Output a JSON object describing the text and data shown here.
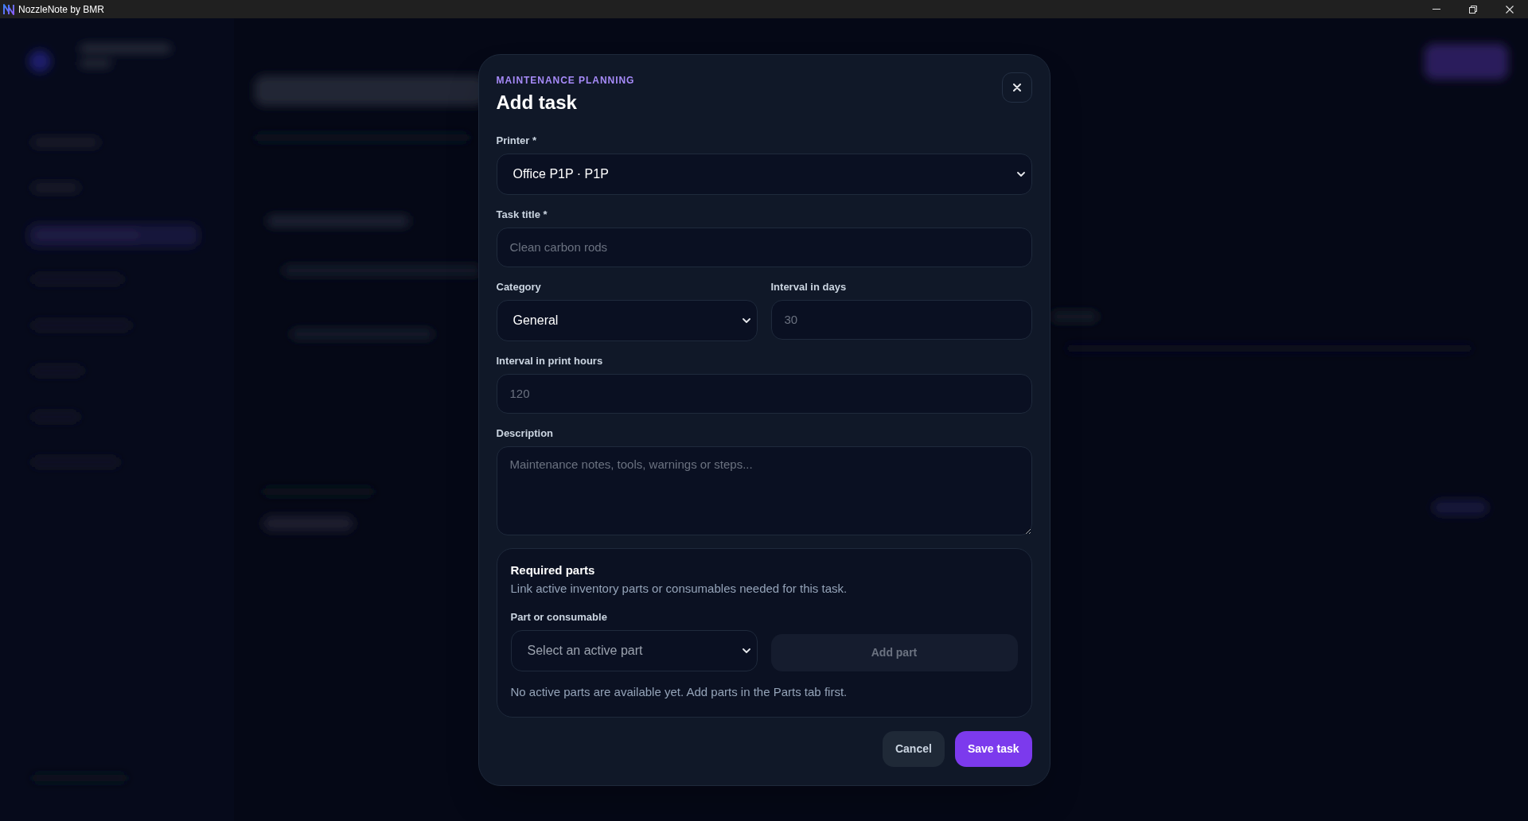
{
  "window": {
    "title": "NozzleNote by BMR"
  },
  "dialog": {
    "eyebrow": "MAINTENANCE PLANNING",
    "title": "Add task",
    "form_rows": [
      {
        "fields": [
          {
            "kind": "select",
            "label": "Printer *",
            "value": "Office P1P · P1P"
          }
        ]
      },
      {
        "fields": [
          {
            "kind": "input",
            "label": "Task title *",
            "placeholder": "Clean carbon rods"
          }
        ]
      },
      {
        "fields": [
          {
            "kind": "select",
            "label": "Category",
            "value": "General"
          },
          {
            "kind": "input",
            "label": "Interval in days",
            "placeholder": "30"
          }
        ]
      },
      {
        "fields": [
          {
            "kind": "input",
            "label": "Interval in print hours",
            "placeholder": "120"
          }
        ]
      },
      {
        "fields": [
          {
            "kind": "textarea",
            "label": "Description",
            "placeholder": "Maintenance notes, tools, warnings or steps..."
          }
        ]
      }
    ],
    "required_parts": {
      "title": "Required parts",
      "description": "Link active inventory parts or consumables needed for this task.",
      "field": {
        "kind": "select",
        "label": "Part or consumable",
        "placeholder": "Select an active part"
      },
      "add_button": {
        "label": "Add part",
        "disabled": true
      },
      "note": "No active parts are available yet. Add parts in the Parts tab first."
    },
    "buttons": [
      {
        "kind": "secondary",
        "label": "Cancel"
      },
      {
        "kind": "primary",
        "label": "Save task"
      }
    ]
  }
}
